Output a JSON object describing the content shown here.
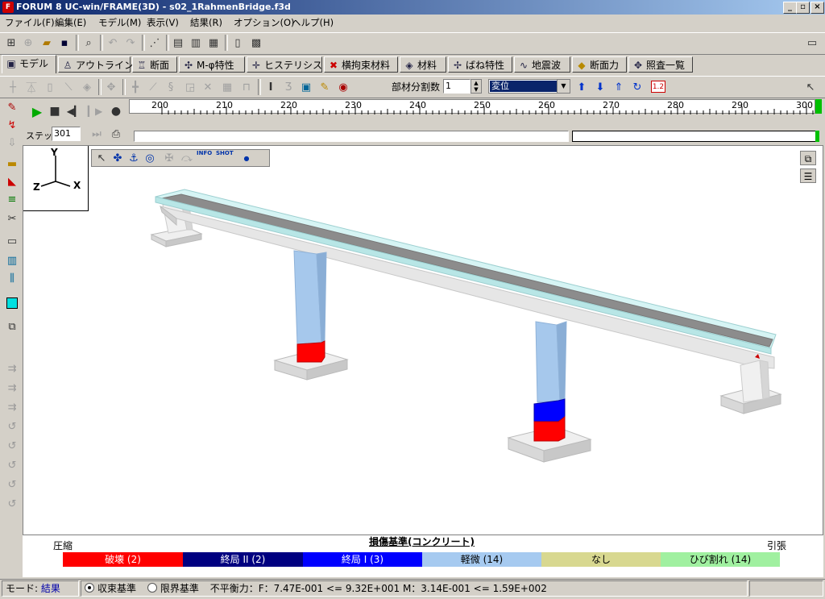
{
  "window": {
    "title": "FORUM 8  UC-win/FRAME(3D) - s02_1RahmenBridge.f3d",
    "app_icon": "forum8-app-icon"
  },
  "menu": [
    "ファイル(F)",
    "編集(E)",
    "モデル(M)",
    "表示(V)",
    "結果(R)",
    "オプション(O)",
    "ヘルプ(H)"
  ],
  "tabs": [
    {
      "label": "モデル",
      "icon": "▣"
    },
    {
      "label": "アウトライン",
      "icon": "♙"
    },
    {
      "label": "断面",
      "icon": "♖"
    },
    {
      "label": "M-φ特性",
      "icon": "✣"
    },
    {
      "label": "ヒステリシス",
      "icon": "✛"
    },
    {
      "label": "横拘束材料",
      "icon": "✖"
    },
    {
      "label": "材料",
      "icon": "◈"
    },
    {
      "label": "ばね特性",
      "icon": "✢"
    },
    {
      "label": "地震波",
      "icon": "∿"
    },
    {
      "label": "断面力",
      "icon": "◆"
    },
    {
      "label": "照査一覧",
      "icon": "✥"
    }
  ],
  "toolbar3": {
    "division_label": "部材分割数",
    "division_value": "1",
    "result_select": "変位",
    "scale_badge": "1.2"
  },
  "playbar": {
    "step_label": "ステップ",
    "step_value": "301"
  },
  "ruler": {
    "ticks": [
      "200",
      "210",
      "220",
      "230",
      "240",
      "250",
      "260",
      "270",
      "280",
      "290",
      "300"
    ]
  },
  "axes": {
    "y": "Y",
    "z": "Z",
    "x": "X"
  },
  "viewport_toolbar": {
    "info": "INFO",
    "shot": "SHOT"
  },
  "legend": {
    "title": "損傷基準(コンクリート)",
    "left_label": "圧縮",
    "right_label": "引張",
    "items": [
      {
        "label": "破壊 (2)",
        "color": "#ff0000",
        "text_color": "#ffffff"
      },
      {
        "label": "終局 II (2)",
        "color": "#000080",
        "text_color": "#ffffff"
      },
      {
        "label": "終局 I (3)",
        "color": "#0000ff",
        "text_color": "#ffffff"
      },
      {
        "label": "軽微 (14)",
        "color": "#a6caf0",
        "text_color": "#000000"
      },
      {
        "label": "なし",
        "color": "#d8d890",
        "text_color": "#000000"
      },
      {
        "label": "ひび割れ (14)",
        "color": "#a0f0a0",
        "text_color": "#000000"
      }
    ]
  },
  "status": {
    "mode_label": "モード:",
    "mode_value": "結果",
    "radio1": "収束基準",
    "radio2": "限界基準",
    "message": "不平衡力：F：7.47E-001 <= 9.32E+001  M：3.14E-001 <= 1.59E+002"
  },
  "colors": {
    "deck_top": "#d6f4f4",
    "deck_road": "#8c8c8c",
    "pier": "#a6c8ec",
    "damage_break": "#ff0000",
    "damage_ultimate1": "#0000ff"
  }
}
